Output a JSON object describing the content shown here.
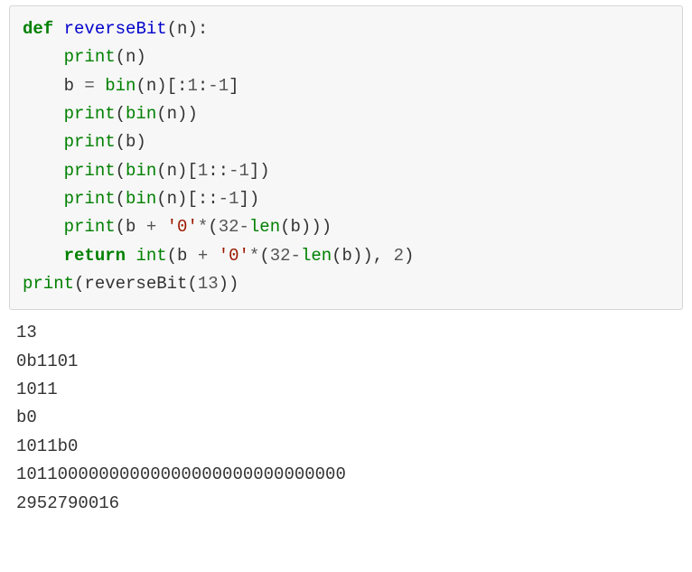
{
  "code": {
    "t1": "def",
    "t2": " ",
    "t3": "reverseBit",
    "t4": "(n):",
    "l2a": "    ",
    "l2b": "print",
    "l2c": "(n)",
    "l3a": "    b ",
    "l3b": "=",
    "l3c": " ",
    "l3d": "bin",
    "l3e": "(n)[:",
    "l3f": "1",
    "l3g": ":",
    "l3h": "-",
    "l3i": "1",
    "l3j": "]",
    "l4a": "    ",
    "l4b": "print",
    "l4c": "(",
    "l4d": "bin",
    "l4e": "(n))",
    "l5a": "    ",
    "l5b": "print",
    "l5c": "(b)",
    "l6a": "    ",
    "l6b": "print",
    "l6c": "(",
    "l6d": "bin",
    "l6e": "(n)[",
    "l6f": "1",
    "l6g": "::",
    "l6h": "-",
    "l6i": "1",
    "l6j": "])",
    "l7a": "    ",
    "l7b": "print",
    "l7c": "(",
    "l7d": "bin",
    "l7e": "(n)[::",
    "l7f": "-",
    "l7g": "1",
    "l7h": "])",
    "l8a": "    ",
    "l8b": "print",
    "l8c": "(b ",
    "l8d": "+",
    "l8e": " ",
    "l8f": "'0'",
    "l8g": "*",
    "l8h": "(",
    "l8i": "32",
    "l8j": "-",
    "l8k": "len",
    "l8l": "(b)))",
    "l9a": "    ",
    "l9b": "return",
    "l9c": " ",
    "l9d": "int",
    "l9e": "(b ",
    "l9f": "+",
    "l9g": " ",
    "l9h": "'0'",
    "l9i": "*",
    "l9j": "(",
    "l9k": "32",
    "l9l": "-",
    "l9m": "len",
    "l9n": "(b)), ",
    "l9o": "2",
    "l9p": ")",
    "l10a": "print",
    "l10b": "(reverseBit(",
    "l10c": "13",
    "l10d": "))"
  },
  "output": {
    "o1": "13",
    "o2": "0b1101",
    "o3": "1011",
    "o4": "b0",
    "o5": "1011b0",
    "o6": "10110000000000000000000000000000",
    "o7": "2952790016"
  }
}
